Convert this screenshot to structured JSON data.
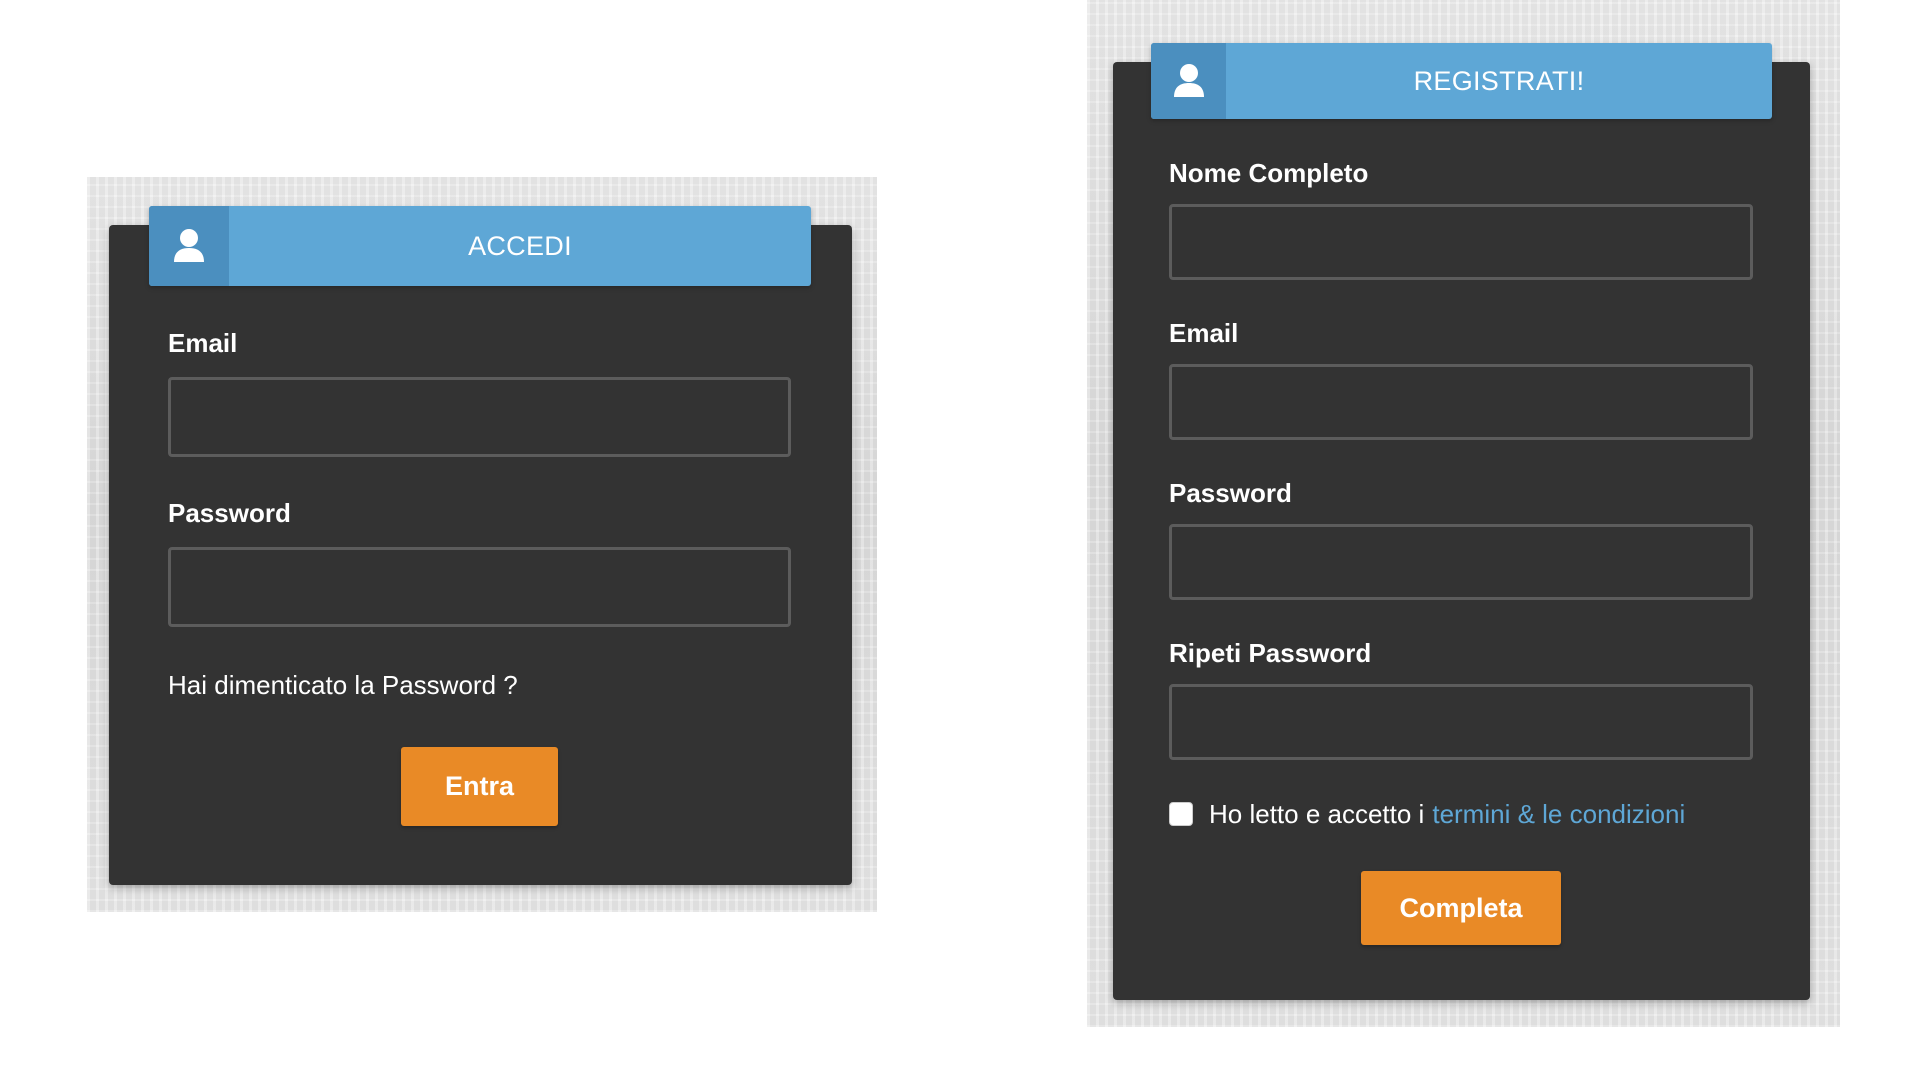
{
  "theme": {
    "panel_color": "#333333",
    "header_color": "#5ea7d6",
    "header_icon_color": "#4b8fbf",
    "accent_button_color": "#e98a26",
    "link_color": "#5ea7d6"
  },
  "login": {
    "header": {
      "icon": "user-icon",
      "title": "ACCEDI"
    },
    "email_label": "Email",
    "email_value": "",
    "password_label": "Password",
    "password_value": "",
    "forgot_password_text": "Hai dimenticato la Password ?",
    "submit_label": "Entra"
  },
  "register": {
    "header": {
      "icon": "user-icon",
      "title": "REGISTRATI!"
    },
    "full_name_label": "Nome Completo",
    "full_name_value": "",
    "email_label": "Email",
    "email_value": "",
    "password_label": "Password",
    "password_value": "",
    "repeat_password_label": "Ripeti Password",
    "repeat_password_value": "",
    "terms_checked": false,
    "terms_text": "Ho letto e accetto i",
    "terms_link_text": "termini & le condizioni",
    "submit_label": "Completa"
  }
}
